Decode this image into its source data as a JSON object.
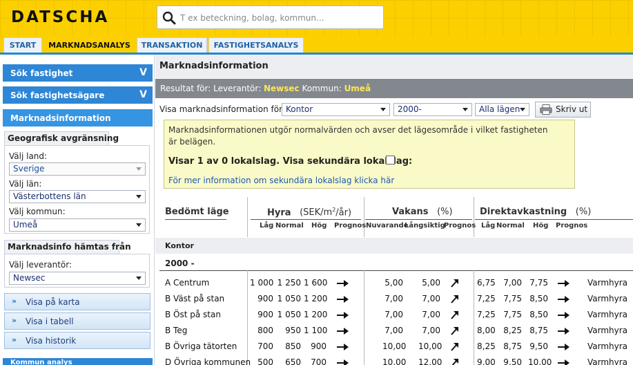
{
  "header": {
    "logo": "DATSCHA",
    "search_placeholder": "T ex beteckning, bolag, kommun..."
  },
  "tabs": [
    "START",
    "MARKNADSANALYS",
    "TRANSAKTION",
    "FASTIGHETSANALYS"
  ],
  "sidebar": {
    "sok_fastighet": "Sök fastighet",
    "sok_agare": "Sök fastighetsägare",
    "chevron": "V",
    "marknadsinfo": "Marknadsinformation",
    "geo_title": "Geografisk avgränsning",
    "land_label": "Välj land:",
    "land_value": "Sverige",
    "lan_label": "Välj län:",
    "lan_value": "Västerbottens län",
    "kommun_label": "Välj kommun:",
    "kommun_value": "Umeå",
    "hamtas_title": "Marknadsinfo hämtas från",
    "lev_label": "Välj leverantör:",
    "lev_value": "Newsec",
    "btn_karta": "Visa på karta",
    "btn_tabell": "Visa i tabell",
    "btn_historik": "Visa historik",
    "btn_chevron": "»",
    "bottom_label": "Kommun analys"
  },
  "main": {
    "title": "Marknadsinformation",
    "result_prefix": "Resultat för: Leverantör:",
    "result_lev": "Newsec",
    "result_mid": "Kommun:",
    "result_kommun": "Umeå",
    "filter_label": "Visa marknadsinformation för:",
    "filter_type": "Kontor",
    "filter_year": "2000-",
    "filter_area": "Alla lägen",
    "print_label": "Skriv ut",
    "notice_text": "Marknadsinformationen utgör normalvärden och avser det lägesområde i vilket fastigheten är belägen.",
    "notice_bold": "Visar 1 av 0 lokalslag. Visa sekundära lokalslag:",
    "notice_link": "För mer information om sekundära lokalslag klicka här"
  },
  "table": {
    "col_lage": "Bedömt läge",
    "col_hyra": "Hyra",
    "hyra_unit_pre": "(SEK/m",
    "hyra_unit_sup": "2",
    "hyra_unit_post": "/år)",
    "col_vakans": "Vakans",
    "vakans_unit": "(%)",
    "col_direkt": "Direktavkastning",
    "direkt_unit": "(%)",
    "sub_hyra": [
      "Låg",
      "Normal",
      "Hög",
      "Prognos"
    ],
    "sub_vakans": [
      "Nuvarande",
      "Långsiktig",
      "Prognos"
    ],
    "sub_direkt": [
      "Låg",
      "Normal",
      "Hög",
      "Prognos"
    ],
    "section": "Kontor",
    "year_section": "2000 -",
    "rows": [
      {
        "lage": "A Centrum",
        "hl": "1 000",
        "hn": "1 250",
        "hh": "1 600",
        "hp": "right",
        "vn": "5,00",
        "vl": "5,00",
        "vp": "up",
        "dl": "6,75",
        "dn": "7,00",
        "dh": "7,75",
        "dp": "right",
        "typ": "Varmhyra"
      },
      {
        "lage": "B Väst på stan",
        "hl": "900",
        "hn": "1 050",
        "hh": "1 200",
        "hp": "right",
        "vn": "7,00",
        "vl": "7,00",
        "vp": "up",
        "dl": "7,25",
        "dn": "7,75",
        "dh": "8,50",
        "dp": "right",
        "typ": "Varmhyra"
      },
      {
        "lage": "B Öst på stan",
        "hl": "900",
        "hn": "1 050",
        "hh": "1 200",
        "hp": "right",
        "vn": "7,00",
        "vl": "7,00",
        "vp": "up",
        "dl": "7,25",
        "dn": "7,75",
        "dh": "8,50",
        "dp": "right",
        "typ": "Varmhyra"
      },
      {
        "lage": "B Teg",
        "hl": "800",
        "hn": "950",
        "hh": "1 100",
        "hp": "right",
        "vn": "7,00",
        "vl": "7,00",
        "vp": "up",
        "dl": "8,00",
        "dn": "8,25",
        "dh": "8,75",
        "dp": "right",
        "typ": "Varmhyra"
      },
      {
        "lage": "B Övriga tätorten",
        "hl": "700",
        "hn": "850",
        "hh": "900",
        "hp": "right",
        "vn": "10,00",
        "vl": "10,00",
        "vp": "up",
        "dl": "8,25",
        "dn": "8,75",
        "dh": "9,50",
        "dp": "right",
        "typ": "Varmhyra"
      },
      {
        "lage": "D Övriga kommunen",
        "hl": "500",
        "hn": "650",
        "hh": "700",
        "hp": "right",
        "vn": "10,00",
        "vl": "12,00",
        "vp": "up",
        "dl": "9,00",
        "dn": "9,50",
        "dh": "10,00",
        "dp": "right",
        "typ": "Varmhyra"
      }
    ]
  }
}
